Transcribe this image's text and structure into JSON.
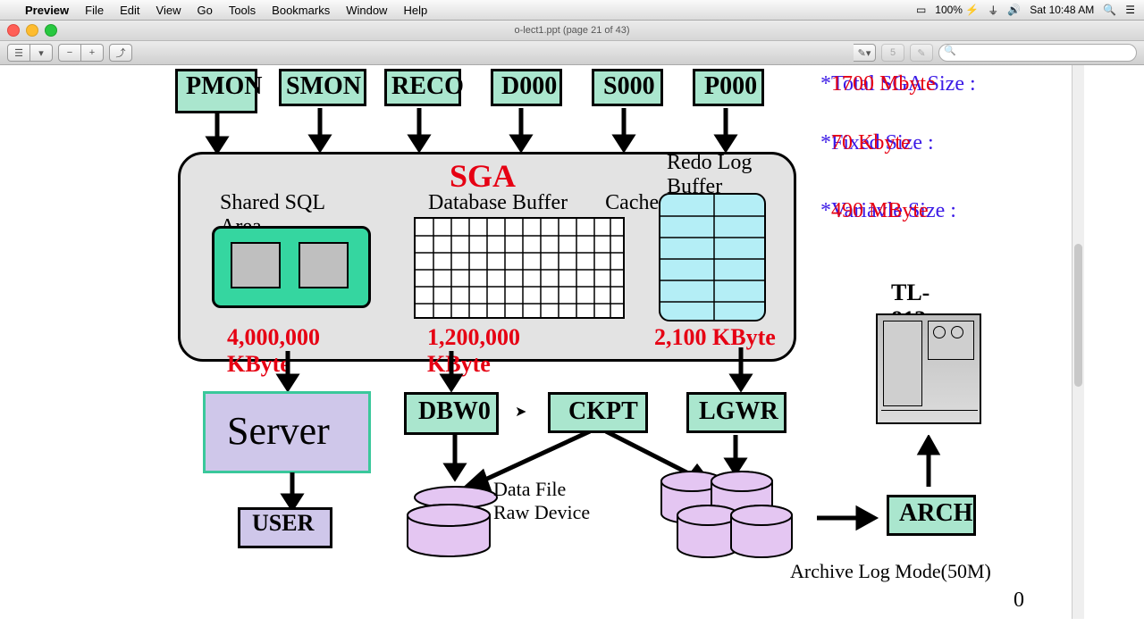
{
  "menubar": {
    "app": "Preview",
    "items": [
      "File",
      "Edit",
      "View",
      "Go",
      "Tools",
      "Bookmarks",
      "Window",
      "Help"
    ],
    "battery": "100%",
    "clock": "Sat 10:48 AM"
  },
  "window": {
    "title": "o-lect1.ppt (page 21 of 43)",
    "search_placeholder": ""
  },
  "processes": [
    "PMON",
    "SMON",
    "RECO",
    "D000",
    "S000",
    "P000"
  ],
  "sga": {
    "title": "SGA",
    "shared_label": "Shared SQL Area",
    "db_label": "Database Buffer       Cache",
    "redo_label": "Redo Log Buffer",
    "sizes": [
      "4,000,000 KByte",
      "1,200,000 KByte",
      "2,100 KByte"
    ]
  },
  "bottom": {
    "server": "Server",
    "dbw": "DBW0",
    "ckpt": "CKPT",
    "lgwr": "LGWR",
    "user": "USER",
    "datafile": "Data File\nRaw Device",
    "arch": "ARCH",
    "archmode": "Archive Log Mode(50M)",
    "tl": "TL-812"
  },
  "stats": [
    {
      "label": "Total SGA Size :",
      "value": "1700 Mbyte"
    },
    {
      "label": "Fixed Size        :",
      "value": "70 Kbyte"
    },
    {
      "label": "Variavle Size     :",
      "value": "490 MByte"
    }
  ],
  "page": "0"
}
